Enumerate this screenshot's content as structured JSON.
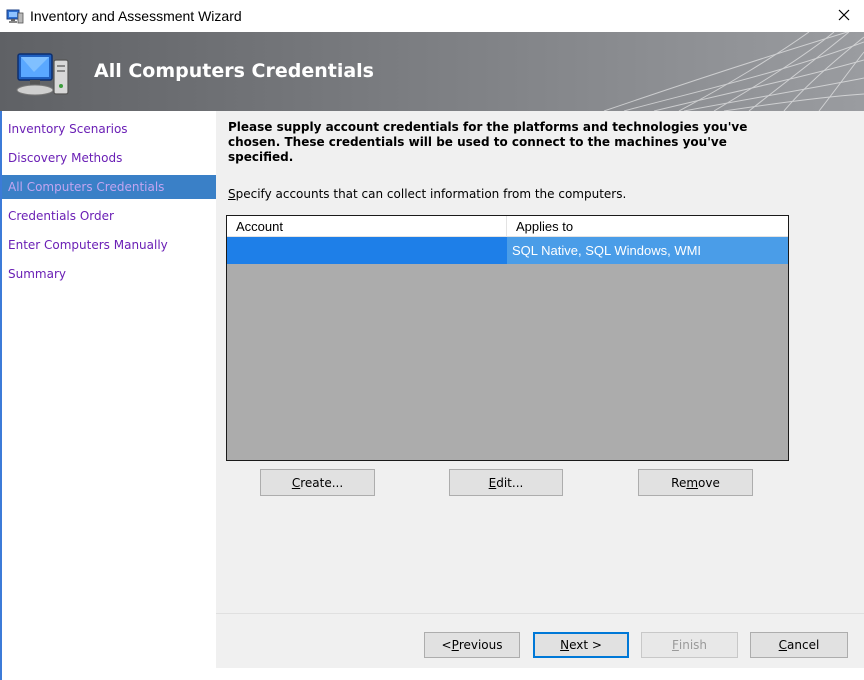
{
  "window": {
    "title": "Inventory and Assessment Wizard",
    "close_glyph": "✕"
  },
  "banner": {
    "title": "All Computers Credentials",
    "icon": "computer-icon"
  },
  "sidebar": {
    "items": [
      {
        "label": "Inventory Scenarios",
        "active": false
      },
      {
        "label": "Discovery Methods",
        "active": false
      },
      {
        "label": "All Computers Credentials",
        "active": true
      },
      {
        "label": "Credentials Order",
        "active": false
      },
      {
        "label": "Enter Computers Manually",
        "active": false
      },
      {
        "label": "Summary",
        "active": false
      }
    ]
  },
  "main": {
    "intro": "Please supply account credentials for the platforms and technologies you've chosen. These credentials will be used to connect to the machines you've specified.",
    "specify_first": "S",
    "specify_rest": "pecify accounts that can collect information from the computers.",
    "table": {
      "columns": [
        "Account",
        "Applies to"
      ],
      "rows": [
        {
          "account": "",
          "applies_to": "SQL Native, SQL Windows, WMI"
        }
      ]
    },
    "buttons": {
      "create_pre": "",
      "create_u": "C",
      "create_post": "reate...",
      "edit_pre": "",
      "edit_u": "E",
      "edit_post": "dit...",
      "remove_pre": "Re",
      "remove_u": "m",
      "remove_post": "ove"
    }
  },
  "footer": {
    "prev_pre": "< ",
    "prev_u": "P",
    "prev_post": "revious",
    "next_pre": "",
    "next_u": "N",
    "next_post": "ext >",
    "finish_pre": "",
    "finish_u": "F",
    "finish_post": "inish",
    "cancel_pre": "",
    "cancel_u": "C",
    "cancel_post": "ancel"
  },
  "colors": {
    "accent": "#3a80c7",
    "selection": "#1e7fe8",
    "nav_link": "#6a1fb5"
  }
}
